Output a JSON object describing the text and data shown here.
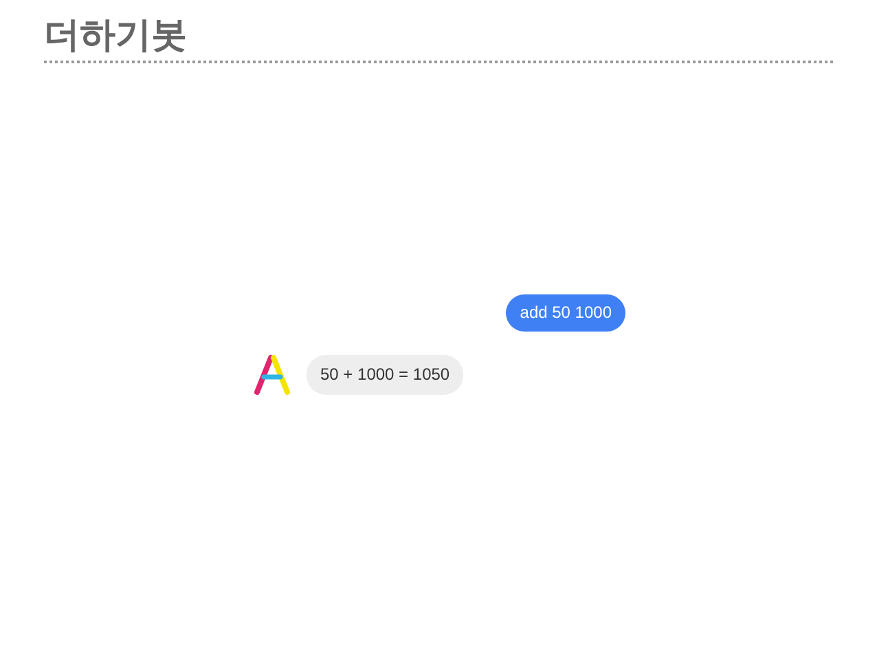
{
  "title": "더하기봇",
  "messages": [
    {
      "kind": "user",
      "text": "add 50 1000"
    },
    {
      "kind": "bot",
      "text": "50 + 1000 = 1050"
    }
  ]
}
